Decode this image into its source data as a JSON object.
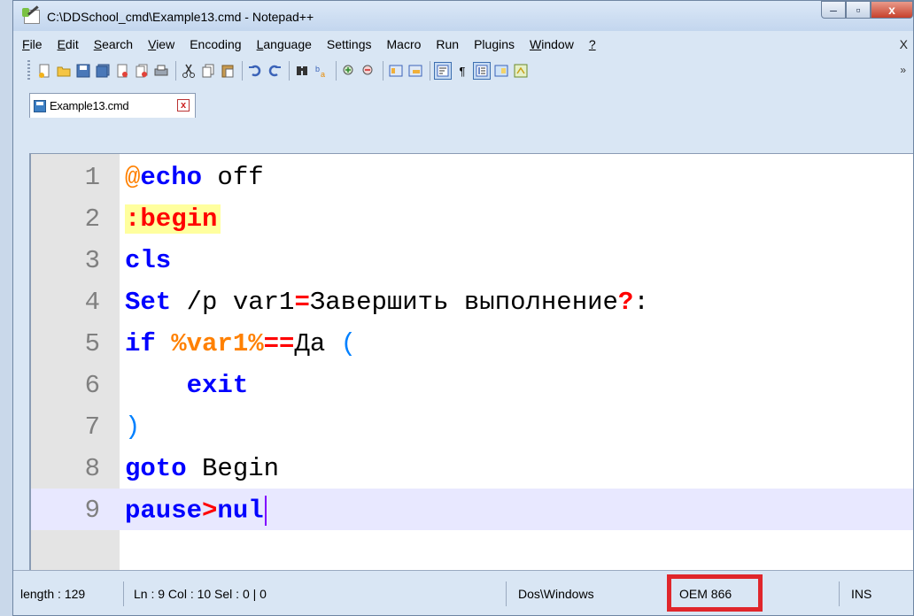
{
  "window": {
    "title": "C:\\DDSchool_cmd\\Example13.cmd - Notepad++",
    "controls": {
      "minimize": "–",
      "maximize": "▫",
      "close": "x"
    }
  },
  "menu": {
    "items": [
      {
        "first": "F",
        "rest": "ile"
      },
      {
        "first": "E",
        "rest": "dit"
      },
      {
        "first": "S",
        "rest": "earch"
      },
      {
        "first": "V",
        "rest": "iew"
      },
      {
        "first": "",
        "rest": "Encoding"
      },
      {
        "first": "L",
        "rest": "anguage"
      },
      {
        "first": "",
        "rest": "Settings"
      },
      {
        "first": "",
        "rest": "Macro"
      },
      {
        "first": "",
        "rest": "Run"
      },
      {
        "first": "",
        "rest": "Plugins"
      },
      {
        "first": "W",
        "rest": "indow"
      },
      {
        "first": "?",
        "rest": ""
      }
    ],
    "close_doc": "X"
  },
  "toolbar": {
    "icons": [
      "new-file-icon",
      "open-file-icon",
      "save-icon",
      "save-all-icon",
      "close-icon",
      "close-all-icon",
      "print-icon",
      "cut-icon",
      "copy-icon",
      "paste-icon",
      "undo-icon",
      "redo-icon",
      "find-icon",
      "replace-icon",
      "zoom-in-icon",
      "zoom-out-icon",
      "sync-vertical-icon",
      "sync-horizontal-icon",
      "word-wrap-icon",
      "show-all-chars-icon",
      "indent-guide-icon",
      "doc-map-icon",
      "function-list-icon"
    ],
    "pilcrow": "¶",
    "more": "»"
  },
  "tab": {
    "label": "Example13.cmd",
    "close": "x"
  },
  "editor": {
    "line_numbers": [
      "1",
      "2",
      "3",
      "4",
      "5",
      "6",
      "7",
      "8",
      "9"
    ],
    "lines": {
      "l1_at": "@",
      "l1_kw": "echo",
      "l1_rest": " off",
      "l2_label": ":begin",
      "l3_kw": "cls",
      "l4_kw": "Set",
      "l4_a": " /p var1",
      "l4_eq": "=",
      "l4_b": "Завершить выполнение",
      "l4_q": "?",
      "l4_c": ":",
      "l5_kw": "if",
      "l5_sp": " ",
      "l5_var": "%var1%",
      "l5_eq": "==",
      "l5_b": "Да ",
      "l5_paren": "(",
      "l6_indent": "    ",
      "l6_kw": "exit",
      "l7_paren": ")",
      "l8_kw": "goto",
      "l8_rest": " Begin",
      "l9_kw": "pause",
      "l9_op": ">",
      "l9_kw2": "nul"
    },
    "current_line": 9
  },
  "status": {
    "length": "length : 129",
    "position": "Ln : 9    Col : 10    Sel : 0 | 0",
    "eol": "Dos\\Windows",
    "encoding": "OEM 866",
    "mode": "INS"
  },
  "colors": {
    "keyword": "#0000ff",
    "label": "#ff0000",
    "label_bg": "#ffff9e",
    "variable": "#ff8000",
    "current_line_bg": "#e8e8ff",
    "highlight_box": "#e0262b"
  }
}
